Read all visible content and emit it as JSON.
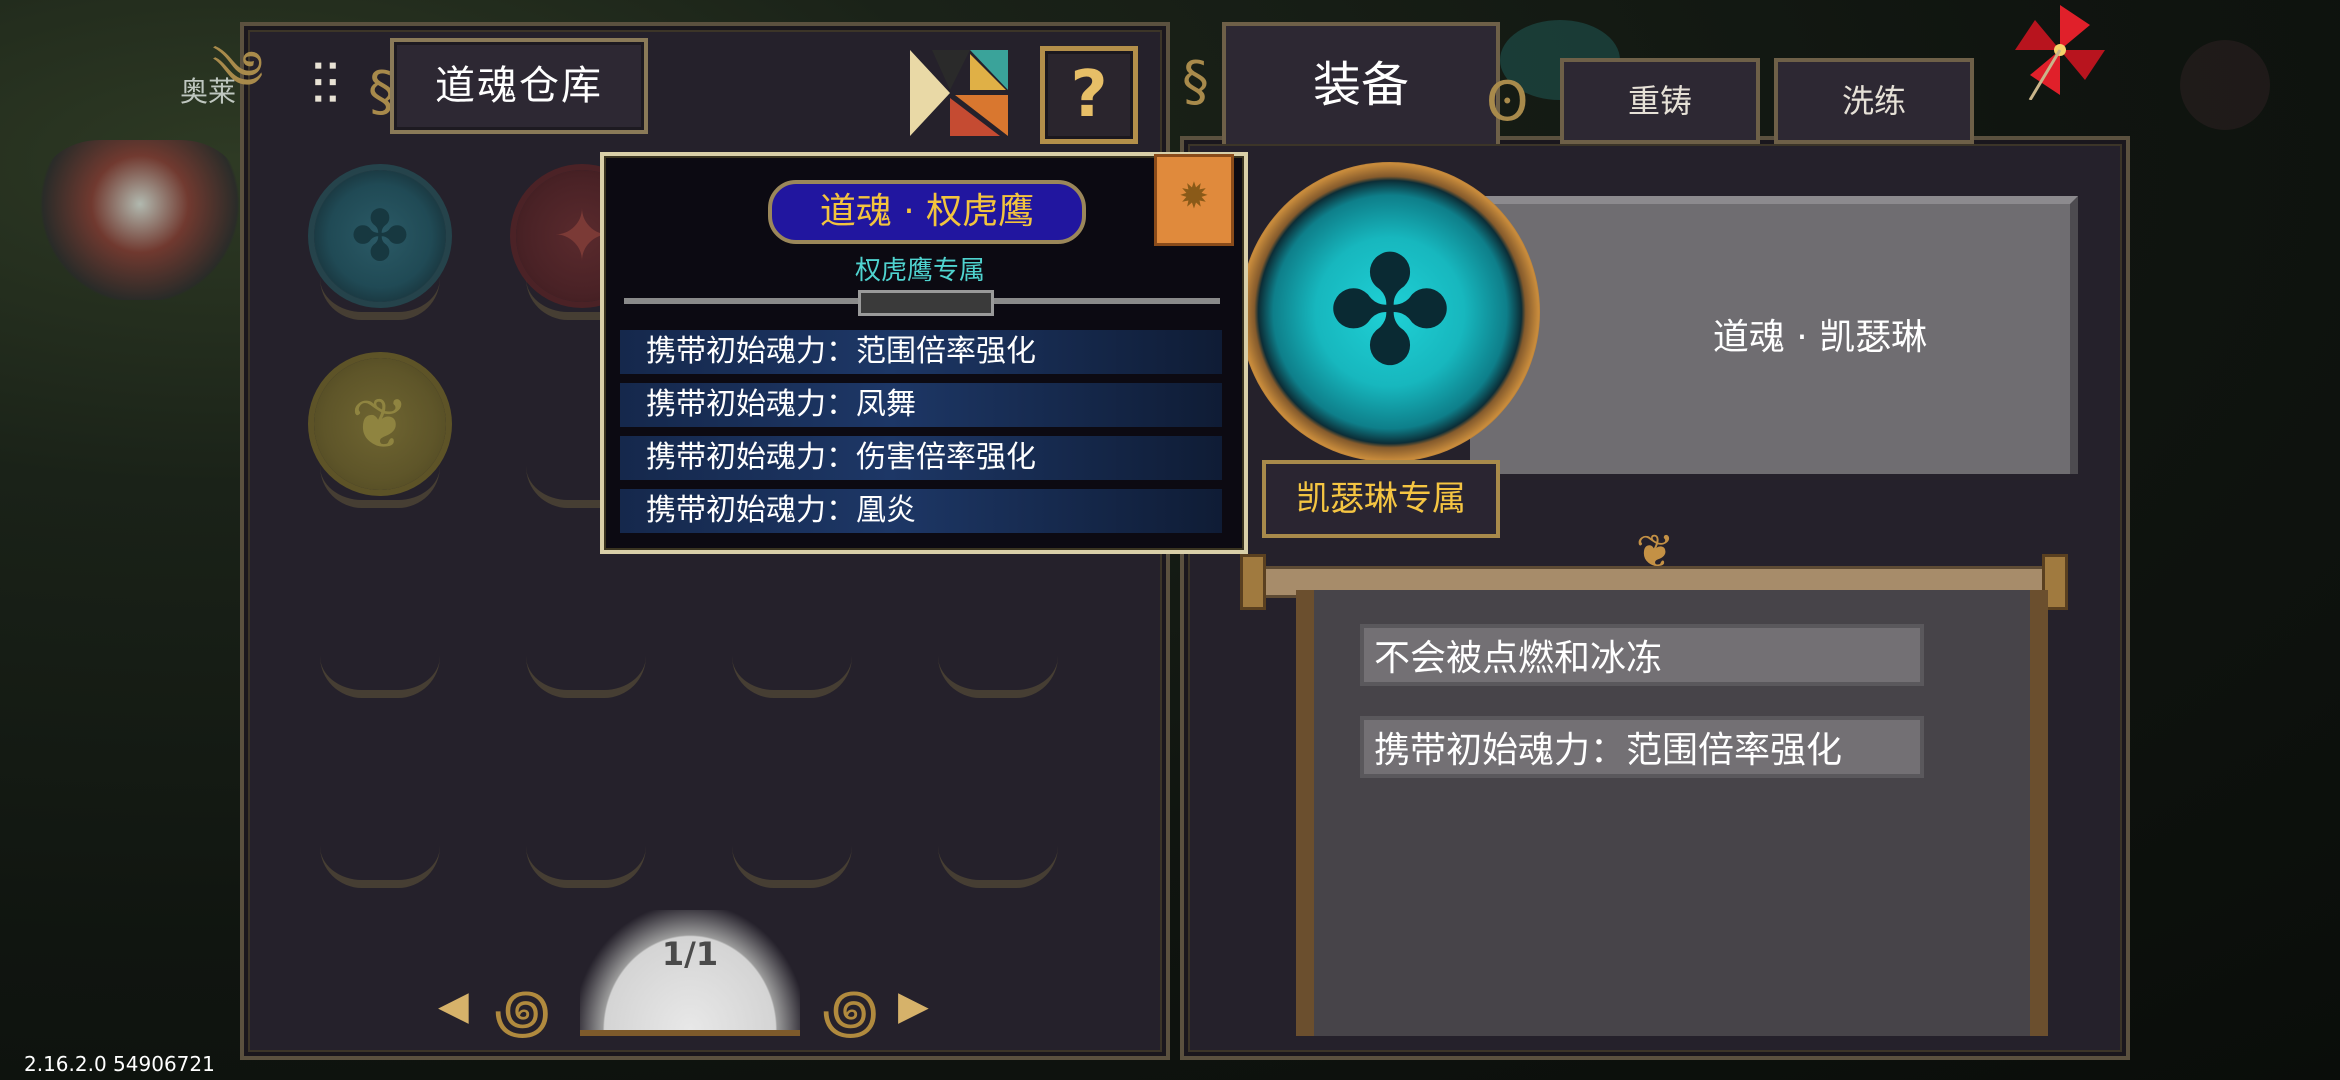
{
  "background": {
    "player_name": "奥莱"
  },
  "warehouse": {
    "title": "道魂仓库",
    "help_label": "?",
    "page_indicator": "1/1",
    "slots": [
      {
        "orb": "teal",
        "icon": "clover-skull-icon"
      },
      {
        "orb": "red",
        "icon": "beast-icon"
      },
      {
        "orb": "gold",
        "icon": "scroll-figure-icon"
      }
    ]
  },
  "tabs": {
    "equip": "装备",
    "recast": "重铸",
    "refine": "洗练"
  },
  "detail": {
    "soul_name": "道魂 · 凯瑟琳",
    "exclusive_label": "凯瑟琳专属",
    "attributes": [
      "不会被点燃和冰冻",
      "携带初始魂力：范围倍率强化"
    ]
  },
  "tooltip": {
    "title": "道魂 · 权虎鹰",
    "subtitle": "权虎鹰专属",
    "effects": [
      "携带初始魂力：范围倍率强化",
      "携带初始魂力：凤舞",
      "携带初始魂力：伤害倍率强化",
      "携带初始魂力：凰炎"
    ]
  },
  "version": "2.16.2.0 54906721",
  "colors": {
    "panel_bg": "#25212b",
    "gold_accent": "#b38f4a",
    "teal_orb": "#1fd1d6",
    "tooltip_title_bg": "#21169f",
    "tooltip_title_text": "#f3c43e",
    "exclusive_text": "#f5c542"
  }
}
